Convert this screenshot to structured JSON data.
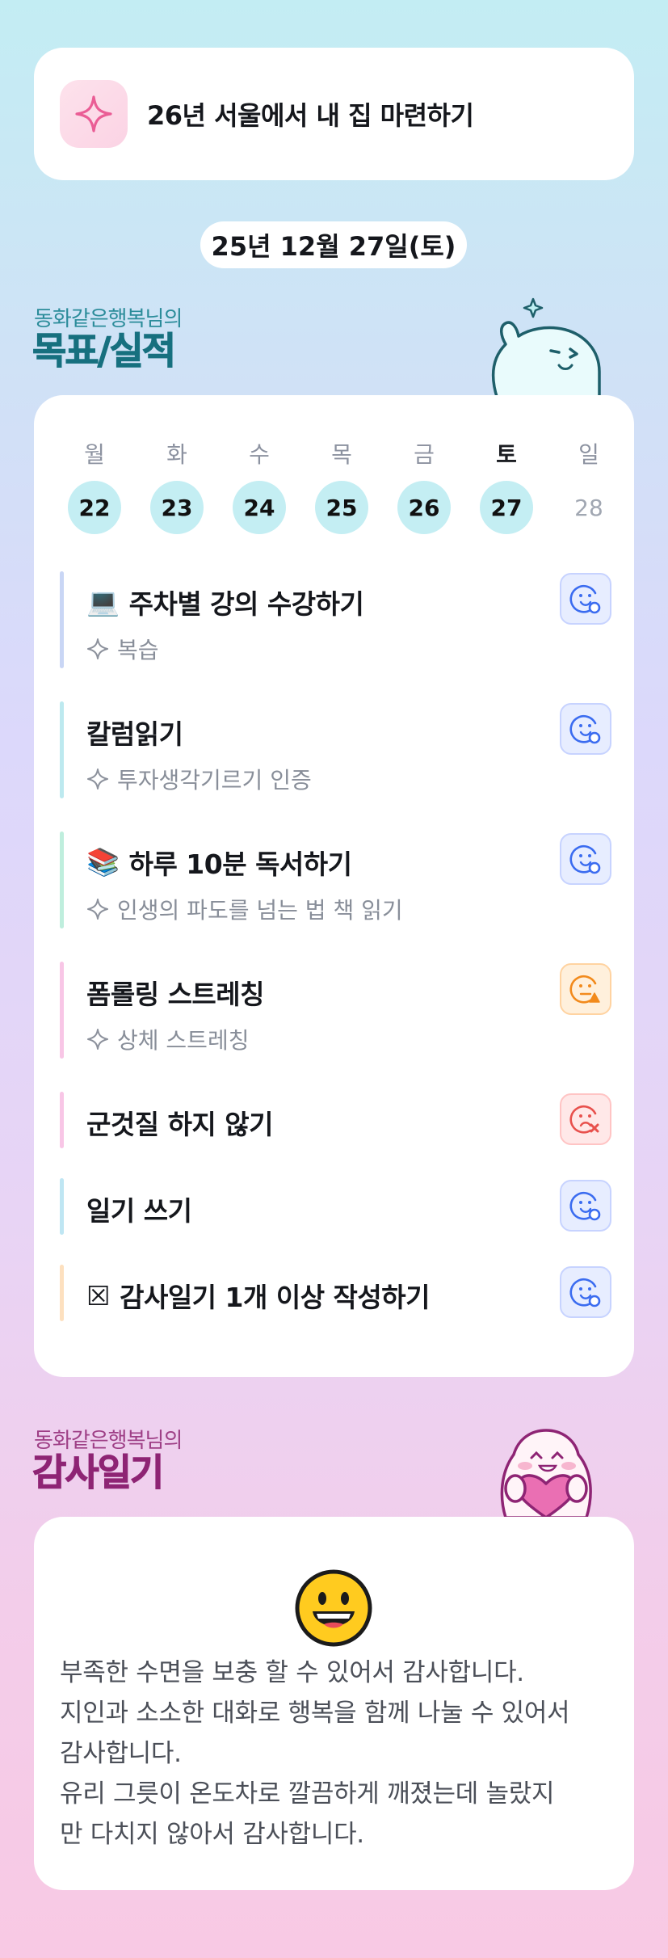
{
  "goal": {
    "title": "26년 서울에서 내 집 마련하기",
    "icon": "sparkle-icon"
  },
  "date": "25년 12월 27일(토)",
  "goals_section": {
    "subtitle": "동화같은행복님의",
    "title": "목표/실적"
  },
  "week": {
    "weekdays": [
      "월",
      "화",
      "수",
      "목",
      "금",
      "토",
      "일"
    ],
    "days": [
      "22",
      "23",
      "24",
      "25",
      "26",
      "27",
      "28"
    ],
    "active_weekday_index": 5
  },
  "tasks": [
    {
      "emoji": "💻",
      "title": "주차별 강의 수강하기",
      "sub": "복습",
      "bar_color": "#c9d6f5",
      "status": "blue"
    },
    {
      "emoji": "",
      "title": "칼럼읽기",
      "sub": "투자생각기르기 인증",
      "bar_color": "#bde9ef",
      "status": "blue"
    },
    {
      "emoji": "📚",
      "title": "하루 10분 독서하기",
      "sub": "인생의 파도를 넘는 법 책 읽기",
      "bar_color": "#bfeedd",
      "status": "blue"
    },
    {
      "emoji": "",
      "title": "폼롤링 스트레칭",
      "sub": "상체 스트레칭",
      "bar_color": "#f8c6e6",
      "status": "orange"
    },
    {
      "emoji": "",
      "title": "군것질 하지 않기",
      "sub": "",
      "bar_color": "#f8c6e6",
      "status": "red"
    },
    {
      "emoji": "",
      "title": "일기 쓰기",
      "sub": "",
      "bar_color": "#bfe6f3",
      "status": "blue"
    },
    {
      "emoji": "",
      "title": "감사일기 1개 이상 작성하기",
      "sub": "",
      "bar_color": "#fde0bf",
      "status": "blue"
    }
  ],
  "task_checkbox_glyph": "☒",
  "gratitude_section": {
    "subtitle": "동화같은행복님의",
    "title": "감사일기"
  },
  "gratitude": {
    "mood_icon": "grinning-face-icon",
    "lines": [
      "부족한 수면을 보충 할 수 있어서 감사합니다.",
      "지인과 소소한 대화로 행복을 함께 나눌 수 있어서",
      "감사합니다.",
      "유리 그릇이 온도차로 깔끔하게 깨졌는데 놀랐지",
      "만 다치지 않아서 감사합니다."
    ]
  },
  "colors": {
    "status_blue": "#3b6cf0",
    "status_orange": "#f28a1c",
    "status_red": "#e8514d",
    "teal_heading": "#17707f",
    "pink_heading": "#8e2474"
  }
}
